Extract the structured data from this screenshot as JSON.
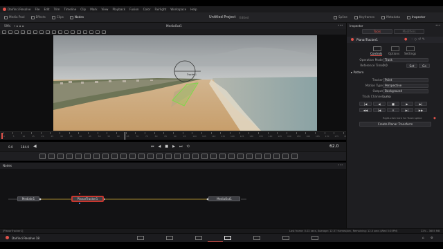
{
  "menu": {
    "app_name": "DaVinci Resolve",
    "items": [
      "File",
      "Edit",
      "Trim",
      "Timeline",
      "Clip",
      "Mark",
      "View",
      "Playback",
      "Fusion",
      "Color",
      "Fairlight",
      "Workspace",
      "Help"
    ]
  },
  "toolbar": {
    "media_pool": "Media Pool",
    "effects": "Effects",
    "clips": "Clips",
    "nodes": "Nodes",
    "project_title": "Untitled Project",
    "project_status": "Edited",
    "spline": "Spline",
    "keyframes": "Keyframes",
    "metadata": "Metadata",
    "inspector": "Inspector"
  },
  "viewer": {
    "zoom": "59%",
    "title": "MediaOut1",
    "tracker_label": "Tracker1"
  },
  "transport": {
    "start": "0.0",
    "end": "184.0",
    "current_frame": "62.0"
  },
  "ruler_ticks": [
    "0",
    "5",
    "10",
    "15",
    "20",
    "25",
    "30",
    "35",
    "40",
    "45",
    "50",
    "55",
    "60",
    "65",
    "70",
    "75",
    "80",
    "85",
    "90",
    "95",
    "100",
    "105",
    "110",
    "115",
    "120",
    "125",
    "130",
    "135",
    "140",
    "145",
    "150",
    "155",
    "160",
    "165",
    "170",
    "175",
    "180"
  ],
  "nodes_panel": {
    "title": "Nodes",
    "node_media_in": "MediaIn1",
    "node_planar": "PlanarTracker1",
    "node_media_out": "MediaOut1"
  },
  "inspector": {
    "title": "Inspector",
    "tab_tools": "Tools",
    "tab_modifiers": "Modifiers",
    "tool_name": "PlanarTracker1",
    "subtab_controls": "Controls",
    "subtab_options": "Options",
    "subtab_settings": "Settings",
    "operation_mode_label": "Operation Mode",
    "operation_mode_value": "Track",
    "reference_time_label": "Reference Time",
    "reference_time_value": "0.0",
    "set_label": "Set",
    "go_label": "Go",
    "pattern_label": "Pattern",
    "tracker_label": "Tracker",
    "tracker_value": "Point",
    "motion_type_label": "Motion Type",
    "motion_type_value": "Perspective",
    "output_label": "Output",
    "output_value": "Background",
    "track_channel_label": "Track Channel",
    "track_channel_value": "Luma",
    "hint": "Right-click here for Track spline",
    "create_button": "Create Planar Transform"
  },
  "status": {
    "left": "[PlanarTracker1]",
    "right": "Last frame: 0.02 secs, Average: 12.57 frames/sec, Remaining: 12.0 secs (Wed 5:05PM)",
    "memory": "22% - 3655 MB"
  },
  "pagebar": {
    "app_label": "DaVinci Resolve 18"
  },
  "colors": {
    "accent_red": "#e2534b",
    "track_green": "#7fd94a",
    "connection_yellow": "#d8b43a",
    "selected_node_red": "#c8372f"
  }
}
